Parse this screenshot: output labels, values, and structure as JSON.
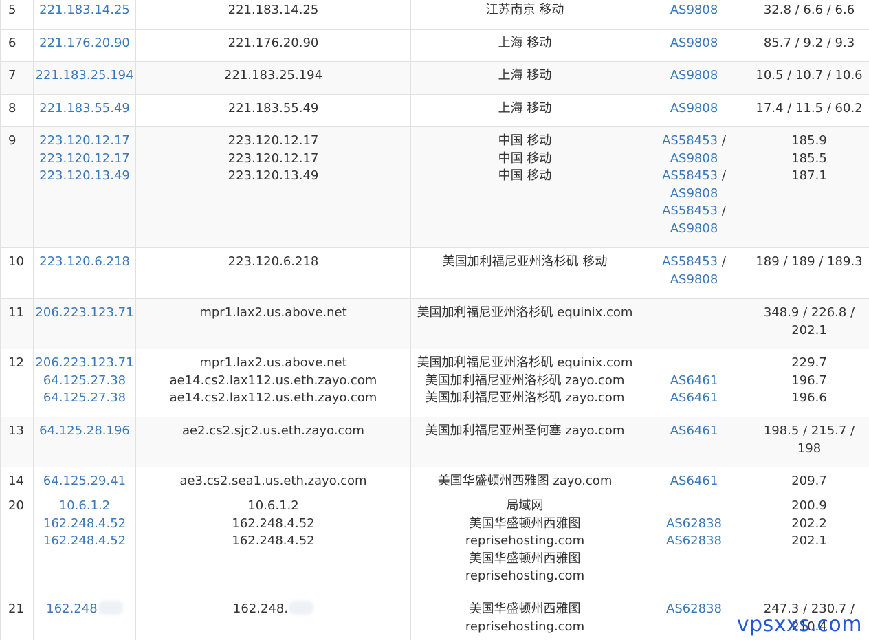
{
  "watermark": "vpsxxs.com",
  "rows": [
    {
      "hop": "5",
      "ips": [
        "221.183.14.25"
      ],
      "hosts": [
        "221.183.14.25"
      ],
      "locs": [
        "江苏南京 移动"
      ],
      "asn": [
        [
          "AS9808"
        ]
      ],
      "latency": [
        "32.8 / 6.6 / 6.6"
      ],
      "alt": false
    },
    {
      "hop": "6",
      "ips": [
        "221.176.20.90"
      ],
      "hosts": [
        "221.176.20.90"
      ],
      "locs": [
        "上海 移动"
      ],
      "asn": [
        [
          "AS9808"
        ]
      ],
      "latency": [
        "85.7 / 9.2 / 9.3"
      ],
      "alt": false
    },
    {
      "hop": "7",
      "ips": [
        "221.183.25.194"
      ],
      "hosts": [
        "221.183.25.194"
      ],
      "locs": [
        "上海 移动"
      ],
      "asn": [
        [
          "AS9808"
        ]
      ],
      "latency": [
        "10.5 / 10.7 / 10.6"
      ],
      "alt": true
    },
    {
      "hop": "8",
      "ips": [
        "221.183.55.49"
      ],
      "hosts": [
        "221.183.55.49"
      ],
      "locs": [
        "上海 移动"
      ],
      "asn": [
        [
          "AS9808"
        ]
      ],
      "latency": [
        "17.4 / 11.5 / 60.2"
      ],
      "alt": false
    },
    {
      "hop": "9",
      "ips": [
        "223.120.12.17",
        "223.120.12.17",
        "223.120.13.49"
      ],
      "hosts": [
        "223.120.12.17",
        "223.120.12.17",
        "223.120.13.49"
      ],
      "locs": [
        "中国 移动",
        "中国 移动",
        "中国 移动"
      ],
      "asn": [
        [
          "AS58453",
          "AS9808"
        ],
        [
          "AS58453",
          "AS9808"
        ],
        [
          "AS58453",
          "AS9808"
        ]
      ],
      "latency": [
        "185.9",
        "185.5",
        "187.1"
      ],
      "alt": true
    },
    {
      "hop": "10",
      "ips": [
        "223.120.6.218"
      ],
      "hosts": [
        "223.120.6.218"
      ],
      "locs": [
        "美国加利福尼亚州洛杉矶 移动"
      ],
      "asn": [
        [
          "AS58453",
          "AS9808"
        ]
      ],
      "latency": [
        "189 / 189 / 189.3"
      ],
      "alt": false
    },
    {
      "hop": "11",
      "ips": [
        "206.223.123.71"
      ],
      "hosts": [
        "mpr1.lax2.us.above.net"
      ],
      "locs": [
        "美国加利福尼亚州洛杉矶 equinix.com"
      ],
      "asn": [],
      "latency": [
        "348.9 / 226.8 /",
        "202.1"
      ],
      "alt": true
    },
    {
      "hop": "12",
      "ips": [
        "206.223.123.71",
        "64.125.27.38",
        "64.125.27.38"
      ],
      "hosts": [
        "mpr1.lax2.us.above.net",
        "ae14.cs2.lax112.us.eth.zayo.com",
        "ae14.cs2.lax112.us.eth.zayo.com"
      ],
      "locs": [
        "美国加利福尼亚州洛杉矶 equinix.com",
        "美国加利福尼亚州洛杉矶 zayo.com",
        "美国加利福尼亚州洛杉矶 zayo.com"
      ],
      "asn": [
        [
          ""
        ],
        [
          "AS6461"
        ],
        [
          "AS6461"
        ]
      ],
      "latency": [
        "229.7",
        "196.7",
        "196.6"
      ],
      "alt": false
    },
    {
      "hop": "13",
      "ips": [
        "64.125.28.196"
      ],
      "hosts": [
        "ae2.cs2.sjc2.us.eth.zayo.com"
      ],
      "locs": [
        "美国加利福尼亚州圣何塞 zayo.com"
      ],
      "asn": [
        [
          "AS6461"
        ]
      ],
      "latency": [
        "198.5 / 215.7 /",
        "198"
      ],
      "alt": true
    },
    {
      "hop": "14",
      "ips": [
        "64.125.29.41"
      ],
      "hosts": [
        "ae3.cs2.sea1.us.eth.zayo.com"
      ],
      "locs": [
        "美国华盛顿州西雅图 zayo.com"
      ],
      "asn": [
        [
          "AS6461"
        ]
      ],
      "latency": [
        "209.7"
      ],
      "alt": false
    },
    {
      "hop": "20",
      "ips": [
        "10.6.1.2",
        "162.248.4.52",
        "162.248.4.52"
      ],
      "hosts": [
        "10.6.1.2",
        "162.248.4.52",
        "162.248.4.52"
      ],
      "locs": [
        "局域网",
        "美国华盛顿州西雅图",
        "reprisehosting.com",
        "美国华盛顿州西雅图",
        "reprisehosting.com"
      ],
      "asn": [
        [
          ""
        ],
        [
          "AS62838"
        ],
        [
          "AS62838"
        ]
      ],
      "latency": [
        "200.9",
        "202.2",
        "202.1"
      ],
      "alt": false
    },
    {
      "hop": "21",
      "ips": [
        "162.248"
      ],
      "hosts": [
        "162.248."
      ],
      "locs": [
        "美国华盛顿州西雅图",
        "reprisehosting.com"
      ],
      "asn": [
        [
          "AS62838"
        ]
      ],
      "latency": [
        "247.3 / 230.7 /",
        "210.4"
      ],
      "alt": false,
      "masked": true
    }
  ]
}
